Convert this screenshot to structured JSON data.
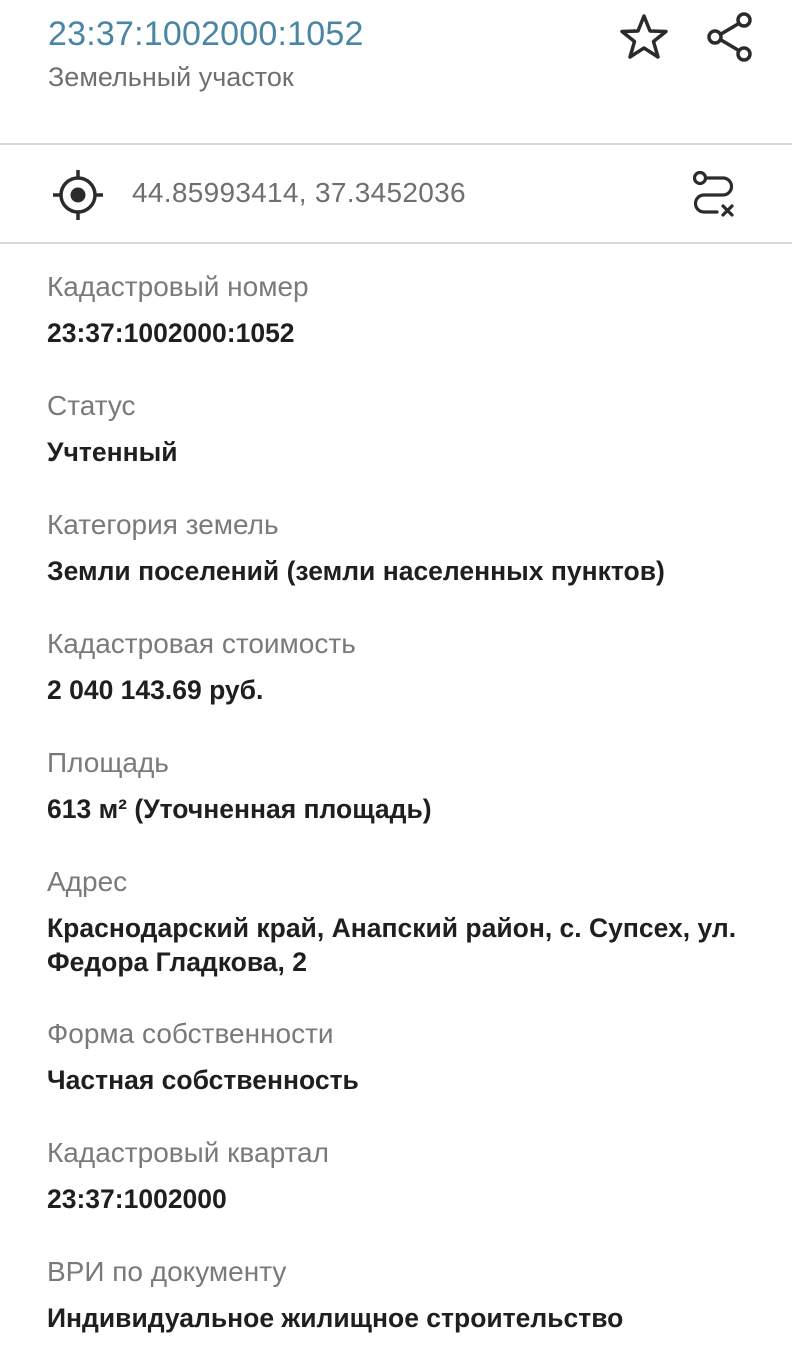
{
  "header": {
    "title": "23:37:1002000:1052",
    "subtitle": "Земельный участок",
    "star_icon": "star-outline-icon",
    "share_icon": "share-icon"
  },
  "location": {
    "coords": "44.85993414, 37.3452036",
    "target_icon": "crosshair-target-icon",
    "route_icon": "route-clear-icon"
  },
  "fields": [
    {
      "label": "Кадастровый номер",
      "value": "23:37:1002000:1052"
    },
    {
      "label": "Статус",
      "value": "Учтенный"
    },
    {
      "label": "Категория земель",
      "value": "Земли поселений (земли населенных пунктов)"
    },
    {
      "label": "Кадастровая стоимость",
      "value": "2 040 143.69 руб."
    },
    {
      "label": "Площадь",
      "value": "613 м² (Уточненная площадь)"
    },
    {
      "label": "Адрес",
      "value": "Краснодарский край, Анапский район, с. Супсех, ул. Федора Гладкова, 2"
    },
    {
      "label": "Форма собственности",
      "value": "Частная собственность"
    },
    {
      "label": "Кадастровый квартал",
      "value": "23:37:1002000"
    },
    {
      "label": "ВРИ по документу",
      "value": "Индивидуальное жилищное строительство"
    }
  ],
  "colors": {
    "accent": "#4a86a4",
    "label": "#7a7a7a",
    "value": "#1f1f1f",
    "divider": "#d8d8d8"
  }
}
